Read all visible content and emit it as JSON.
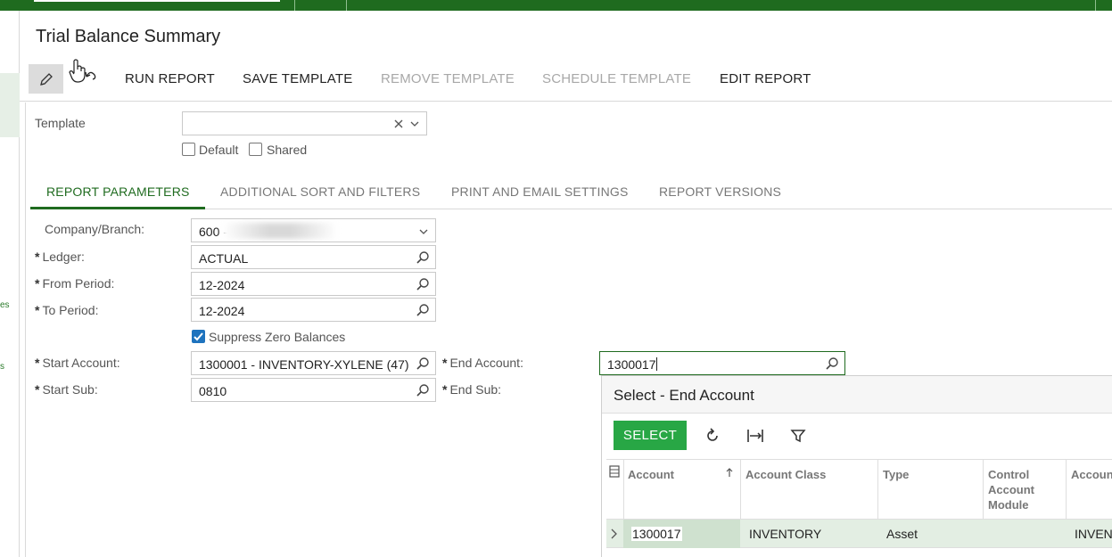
{
  "page": {
    "title": "Trial Balance Summary"
  },
  "toolbar": {
    "run_report": "RUN REPORT",
    "save_template": "SAVE TEMPLATE",
    "remove_template": "REMOVE TEMPLATE",
    "schedule_template": "SCHEDULE TEMPLATE",
    "edit_report": "EDIT REPORT"
  },
  "left_rail": {
    "frag1": "es",
    "frag2": "s"
  },
  "template": {
    "label": "Template",
    "value": "",
    "default_label": "Default",
    "shared_label": "Shared",
    "default_checked": false,
    "shared_checked": false
  },
  "tabs": [
    {
      "label": "REPORT PARAMETERS",
      "active": true
    },
    {
      "label": "ADDITIONAL SORT AND FILTERS",
      "active": false
    },
    {
      "label": "PRINT AND EMAIL SETTINGS",
      "active": false
    },
    {
      "label": "REPORT VERSIONS",
      "active": false
    }
  ],
  "form": {
    "company_branch": {
      "label": "Company/Branch:",
      "value": "600 -"
    },
    "ledger": {
      "label": "Ledger:",
      "value": "ACTUAL"
    },
    "from_period": {
      "label": "From Period:",
      "value": "12-2024"
    },
    "to_period": {
      "label": "To Period:",
      "value": "12-2024"
    },
    "suppress_zero": {
      "label": "Suppress Zero Balances",
      "checked": true
    },
    "start_account": {
      "label": "Start Account:",
      "value": "1300001 - INVENTORY-XYLENE (47)"
    },
    "start_sub": {
      "label": "Start Sub:",
      "value": "0810"
    },
    "end_account": {
      "label": "End Account:",
      "value": "1300017"
    },
    "end_sub": {
      "label": "End Sub:",
      "value": ""
    },
    "required_mark": "*"
  },
  "lookup": {
    "title": "Select - End Account",
    "select_label": "SELECT",
    "columns": [
      "Account",
      "Account Class",
      "Type",
      "Control Account Module",
      "Accoun"
    ],
    "rows": [
      {
        "account": "1300017",
        "account_class": "INVENTORY",
        "type": "Asset",
        "control_module": "",
        "extra": "INVEN"
      }
    ]
  },
  "colors": {
    "brand_green": "#1f6b1f",
    "select_button": "#28a745",
    "checkbox_blue": "#1e73be"
  }
}
